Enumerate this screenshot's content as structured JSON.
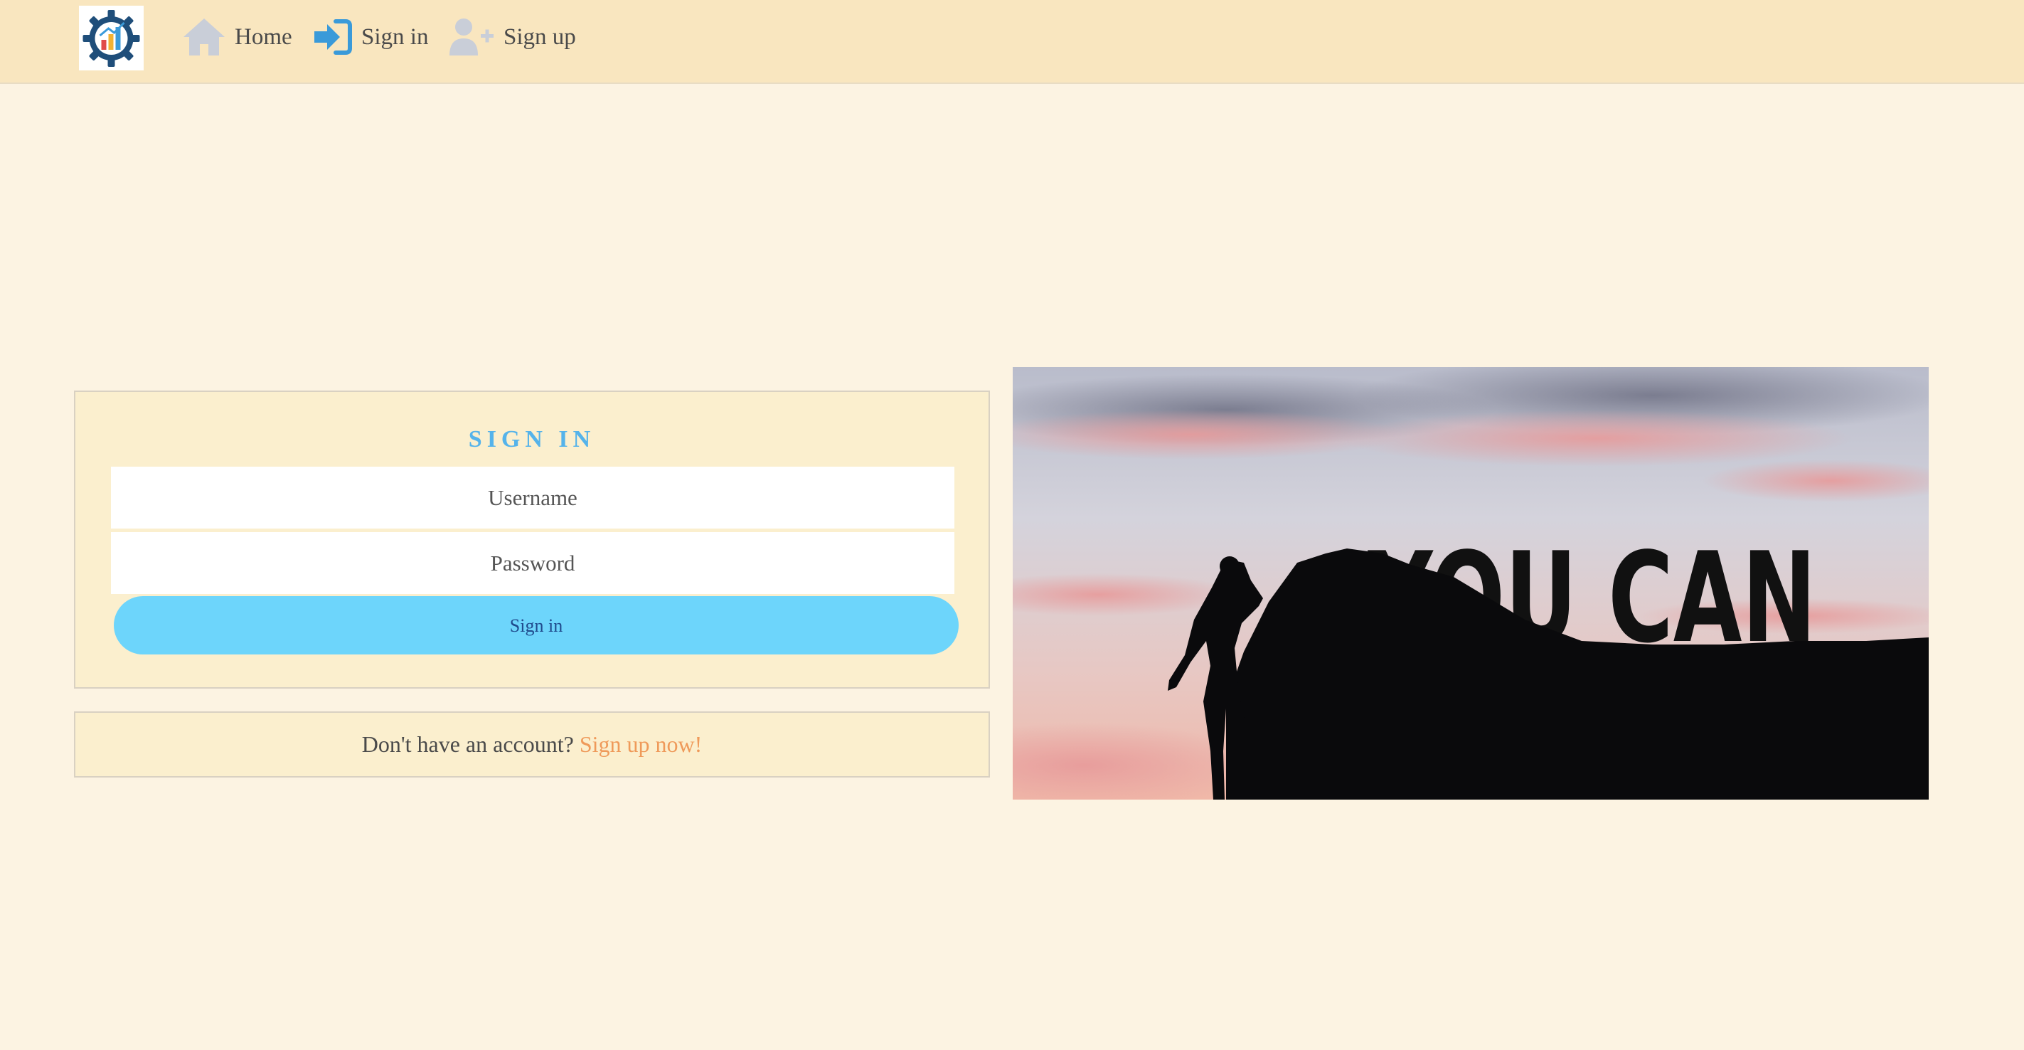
{
  "navbar": {
    "logo_icon": "gear-chart-logo",
    "items": [
      {
        "label": "Home",
        "icon": "home-icon"
      },
      {
        "label": "Sign in",
        "icon": "sign-in-icon"
      },
      {
        "label": "Sign up",
        "icon": "add-user-icon"
      }
    ]
  },
  "signin": {
    "title": "SIGN IN",
    "username_placeholder": "Username",
    "password_placeholder": "Password",
    "button_label": "Sign in"
  },
  "signup_prompt": {
    "text": "Don't have an account? ",
    "link_label": "Sign up now!"
  },
  "hero": {
    "image": "climber-silhouette-you-can",
    "text": "YOU CAN"
  },
  "colors": {
    "navbar_bg": "#f9e6bf",
    "page_bg": "#fcf3e2",
    "title_blue": "#55b3ea",
    "button_blue": "#6dd5fb",
    "link_orange": "#ef9a5a"
  }
}
